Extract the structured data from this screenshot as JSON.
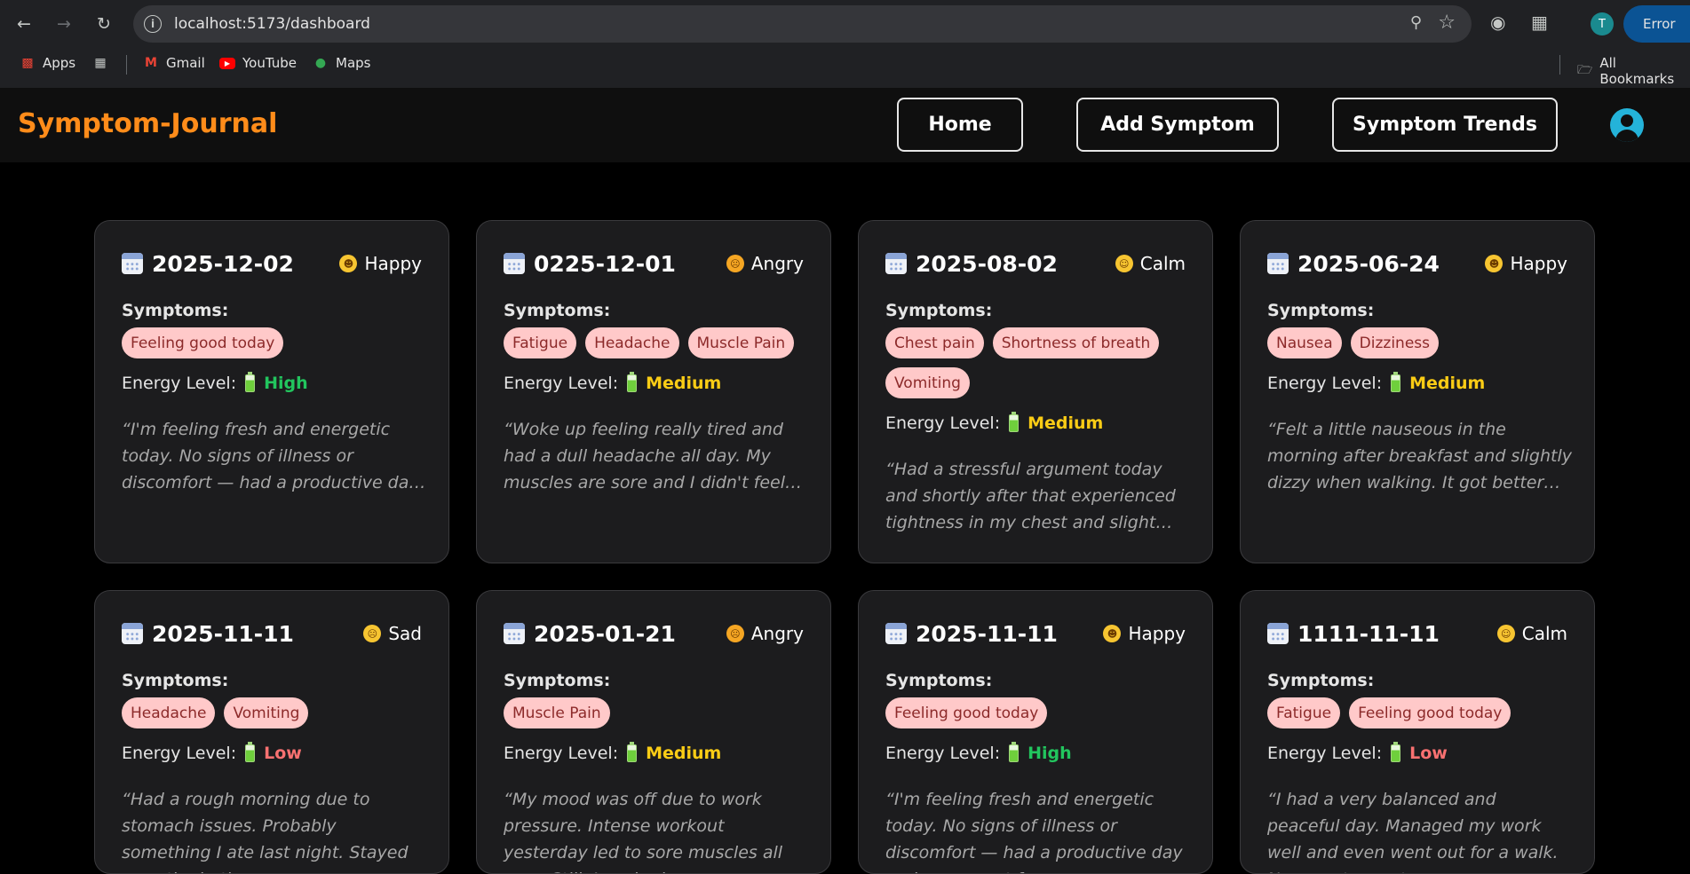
{
  "browser": {
    "url": "localhost:5173/dashboard",
    "profile_initial": "T",
    "error_label": "Error",
    "bookmarks": {
      "apps": "Apps",
      "gmail": "Gmail",
      "youtube": "YouTube",
      "maps": "Maps",
      "all_bookmarks": "All Bookmarks"
    }
  },
  "app": {
    "brand": "Symptom-Journal",
    "nav": {
      "home": "Home",
      "add_symptom": "Add Symptom",
      "symptom_trends": "Symptom Trends"
    },
    "colors": {
      "brand": "#ff8c1a",
      "tag_bg": "#ffc9c9",
      "high": "#22c55e",
      "medium": "#facc15",
      "low": "#f87171"
    }
  },
  "cards": [
    {
      "date": "2025-12-02",
      "mood": "Happy",
      "mood_icon": "happy-emoji-icon",
      "symptoms_label": "Symptoms:",
      "symptoms": [
        "Feeling good today"
      ],
      "energy_label": "Energy Level:",
      "energy": "High",
      "note": "“I'm feeling fresh and energetic today. No signs of illness or discomfort — had a productive day and even went for a..."
    },
    {
      "date": "0225-12-01",
      "mood": "Angry",
      "mood_icon": "angry-emoji-icon",
      "symptoms_label": "Symptoms:",
      "symptoms": [
        "Fatigue",
        "Headache",
        "Muscle Pain"
      ],
      "energy_label": "Energy Level:",
      "energy": "Medium",
      "note": "“Woke up feeling really tired and had a dull headache all day. My muscles are sore and I didn't feel like doing..."
    },
    {
      "date": "2025-08-02",
      "mood": "Calm",
      "mood_icon": "calm-emoji-icon",
      "symptoms_label": "Symptoms:",
      "symptoms": [
        "Chest pain",
        "Shortness of breath",
        "Vomiting"
      ],
      "energy_label": "Energy Level:",
      "energy": "Medium",
      "note": "“Had a stressful argument today and shortly after that experienced tightness in my chest and slight shortness of..."
    },
    {
      "date": "2025-06-24",
      "mood": "Happy",
      "mood_icon": "happy-emoji-icon",
      "symptoms_label": "Symptoms:",
      "symptoms": [
        "Nausea",
        "Dizziness"
      ],
      "energy_label": "Energy Level:",
      "energy": "Medium",
      "note": "“Felt a little nauseous in the morning after breakfast and slightly dizzy when walking. It got better later in the day...."
    },
    {
      "date": "2025-11-11",
      "mood": "Sad",
      "mood_icon": "sad-emoji-icon",
      "symptoms_label": "Symptoms:",
      "symptoms": [
        "Headache",
        "Vomiting"
      ],
      "energy_label": "Energy Level:",
      "energy": "Low",
      "note": "“Had a rough morning due to stomach issues. Probably something I ate last night. Stayed near the bathroom mos..."
    },
    {
      "date": "2025-01-21",
      "mood": "Angry",
      "mood_icon": "angry-emoji-icon",
      "symptoms_label": "Symptoms:",
      "symptoms": [
        "Muscle Pain"
      ],
      "energy_label": "Energy Level:",
      "energy": "Medium",
      "note": "“My mood was off due to work pressure. Intense workout yesterday led to sore muscles all over. Still, I pushed..."
    },
    {
      "date": "2025-11-11",
      "mood": "Happy",
      "mood_icon": "happy-emoji-icon",
      "symptoms_label": "Symptoms:",
      "symptoms": [
        "Feeling good today"
      ],
      "energy_label": "Energy Level:",
      "energy": "High",
      "note": "“I'm feeling fresh and energetic today. No signs of illness or discomfort — had a productive day and even went for a..."
    },
    {
      "date": "1111-11-11",
      "mood": "Calm",
      "mood_icon": "calm-emoji-icon",
      "symptoms_label": "Symptoms:",
      "symptoms": [
        "Fatigue",
        "Feeling good today"
      ],
      "energy_label": "Energy Level:",
      "energy": "Low",
      "note": "“I had a very balanced and peaceful day. Managed my work well and even went out for a walk. No symptoms at..."
    }
  ]
}
